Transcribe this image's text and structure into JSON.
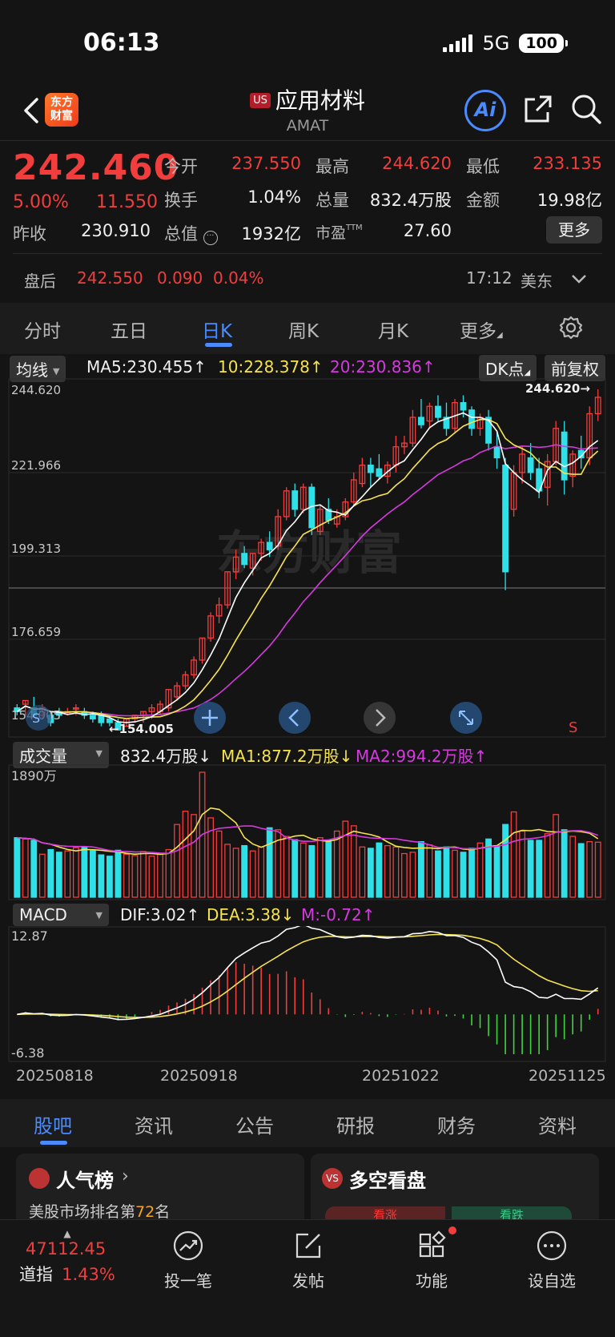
{
  "status_bar": {
    "time": "06:13",
    "network": "5G",
    "battery": "100"
  },
  "header": {
    "logo": "东方\n财富",
    "market_badge": "US",
    "name": "应用材料",
    "code": "AMAT",
    "ai_label": "Ai"
  },
  "quote": {
    "price": "242.460",
    "pct": "5.00%",
    "change": "11.550",
    "prev_close_label": "昨收",
    "prev_close": "230.910",
    "open_label": "今开",
    "open": "237.550",
    "high_label": "最高",
    "high": "244.620",
    "low_label": "最低",
    "low": "233.135",
    "turnover_label": "换手",
    "turnover": "1.04%",
    "volume_label": "总量",
    "volume": "832.4万股",
    "amount_label": "金额",
    "amount": "19.98亿",
    "mktcap_label": "总值",
    "mktcap": "1932亿",
    "pe_label": "市盈",
    "pe_sup": "TTM",
    "pe": "27.60",
    "more_label": "更多"
  },
  "after_hours": {
    "label": "盘后",
    "price": "242.550",
    "change": "0.090",
    "pct": "0.04%",
    "time": "17:12",
    "zone": "美东"
  },
  "period_tabs": [
    "分时",
    "五日",
    "日K",
    "周K",
    "月K",
    "更多"
  ],
  "active_period": "日K",
  "kline": {
    "ma_selector": "均线",
    "ma5": "MA5:230.455↑",
    "ma10": "10:228.378↑",
    "ma20": "20:230.836↑",
    "dk_label": "DK点",
    "adjust_label": "前复权",
    "y_ticks": [
      "244.620",
      "221.966",
      "199.313",
      "176.659",
      "154.005"
    ],
    "max_marker": "244.620→",
    "min_marker": "←154.005",
    "signal_s": "S",
    "watermark": "东方财富"
  },
  "volume": {
    "selector": "成交量",
    "value": "832.4万股↓",
    "ma1": "MA1:877.2万股↓",
    "ma2": "MA2:994.2万股↑",
    "y_top": "1890万"
  },
  "macd": {
    "selector": "MACD",
    "dif": "DIF:3.02↑",
    "dea": "DEA:3.38↓",
    "m": "M:-0.72↑",
    "y_top": "12.87",
    "y_bottom": "-6.38"
  },
  "dates": [
    "20250818",
    "20250918",
    "20251022",
    "20251125"
  ],
  "bottom_tabs": [
    "股吧",
    "资讯",
    "公告",
    "研报",
    "财务",
    "资料"
  ],
  "cards": {
    "popularity": {
      "title": "人气榜",
      "desc_pre": "美股市场排名第",
      "rank": "72",
      "desc_post": "名"
    },
    "sentiment": {
      "title": "多空看盘",
      "bull": "看涨",
      "bear": "看跌"
    }
  },
  "index": {
    "value": "47112.45",
    "name": "道指",
    "pct": "1.43%"
  },
  "nav": [
    "投一笔",
    "发帖",
    "功能",
    "设自选"
  ],
  "colors": {
    "up": "#f23d3d",
    "down": "#2ee0e8",
    "accent": "#4a8cff",
    "ma5": "#ffffff",
    "ma10": "#f5e34f",
    "ma20": "#d63adf"
  },
  "chart_data": [
    {
      "type": "candlestick",
      "title": "",
      "ylim": [
        154.005,
        244.62
      ],
      "y_ticks": [
        244.62,
        221.966,
        199.313,
        176.659,
        154.005
      ],
      "x_tick_labels": [
        "20250818",
        "20250918",
        "20251022",
        "20251125"
      ],
      "ohlc": [
        [
          158,
          159,
          156,
          157
        ],
        [
          159,
          160,
          156,
          160
        ],
        [
          158,
          161,
          156,
          156
        ],
        [
          156,
          159,
          155,
          158
        ],
        [
          156,
          157,
          153,
          154
        ],
        [
          157,
          158,
          155,
          156
        ],
        [
          157,
          158,
          156,
          157
        ],
        [
          158,
          159,
          156,
          158
        ],
        [
          157,
          158,
          155,
          156
        ],
        [
          156,
          157,
          154,
          155
        ],
        [
          156,
          157,
          153,
          154
        ],
        [
          155,
          156,
          153,
          154
        ],
        [
          154,
          155,
          152,
          152
        ],
        [
          153,
          155,
          153,
          155
        ],
        [
          155,
          156,
          154,
          156
        ],
        [
          156,
          157,
          154,
          157
        ],
        [
          157,
          159,
          155,
          158
        ],
        [
          157,
          160,
          156,
          159
        ],
        [
          158,
          163,
          157,
          163
        ],
        [
          161,
          165,
          160,
          164
        ],
        [
          164,
          168,
          163,
          167
        ],
        [
          167,
          172,
          166,
          171
        ],
        [
          171,
          177,
          170,
          177
        ],
        [
          177,
          184,
          176,
          183
        ],
        [
          183,
          188,
          181,
          186
        ],
        [
          186,
          195,
          185,
          195
        ],
        [
          195,
          201,
          193,
          199
        ],
        [
          200,
          202,
          196,
          197
        ],
        [
          196,
          200,
          194,
          200
        ],
        [
          200,
          204,
          198,
          203
        ],
        [
          203,
          206,
          199,
          201
        ],
        [
          202,
          212,
          201,
          210
        ],
        [
          210,
          218,
          209,
          217
        ],
        [
          217,
          219,
          210,
          212
        ],
        [
          212,
          219,
          211,
          218
        ],
        [
          218,
          219,
          205,
          207
        ],
        [
          206,
          213,
          205,
          212
        ],
        [
          212,
          215,
          208,
          209
        ],
        [
          208,
          212,
          207,
          210
        ],
        [
          210,
          215,
          209,
          214
        ],
        [
          214,
          222,
          213,
          220
        ],
        [
          219,
          226,
          218,
          224
        ],
        [
          224,
          226,
          218,
          222
        ],
        [
          223,
          227,
          220,
          221
        ],
        [
          221,
          225,
          219,
          224
        ],
        [
          224,
          232,
          222,
          229
        ],
        [
          229,
          232,
          227,
          230
        ],
        [
          230,
          239,
          229,
          237
        ],
        [
          237,
          242,
          234,
          235
        ],
        [
          236,
          241,
          234,
          240
        ],
        [
          240,
          243,
          236,
          237
        ],
        [
          237,
          241,
          232,
          234
        ],
        [
          234,
          242,
          233,
          241
        ],
        [
          241,
          243,
          237,
          239
        ],
        [
          239,
          240,
          232,
          234
        ],
        [
          234,
          238,
          232,
          237
        ],
        [
          237,
          239,
          228,
          230
        ],
        [
          229,
          233,
          223,
          226
        ],
        [
          224,
          226,
          190,
          195
        ],
        [
          212,
          224,
          210,
          222
        ],
        [
          222,
          229,
          219,
          227
        ],
        [
          226,
          230,
          220,
          222
        ],
        [
          223,
          226,
          215,
          217
        ],
        [
          218,
          227,
          213,
          225
        ],
        [
          225,
          236,
          224,
          234
        ],
        [
          233,
          236,
          216,
          220
        ],
        [
          221,
          228,
          218,
          227
        ],
        [
          228,
          232,
          223,
          226
        ],
        [
          226,
          240,
          224,
          238
        ],
        [
          238,
          244.62,
          236,
          242.46
        ]
      ],
      "volume_wan": [
        900,
        880,
        860,
        650,
        720,
        680,
        700,
        750,
        760,
        700,
        640,
        620,
        710,
        650,
        630,
        690,
        620,
        650,
        720,
        1100,
        1300,
        1250,
        1890,
        1200,
        1000,
        800,
        740,
        780,
        700,
        760,
        1050,
        1020,
        920,
        870,
        820,
        780,
        900,
        860,
        1000,
        1150,
        1080,
        760,
        740,
        820,
        780,
        760,
        660,
        680,
        840,
        790,
        700,
        760,
        710,
        680,
        740,
        820,
        880,
        780,
        1100,
        1290,
        1000,
        860,
        860,
        960,
        1250,
        1020,
        920,
        810,
        840,
        832.4
      ],
      "volume_ylim": [
        0,
        1890
      ],
      "macd_ylim": [
        -6.38,
        12.87
      ]
    }
  ]
}
